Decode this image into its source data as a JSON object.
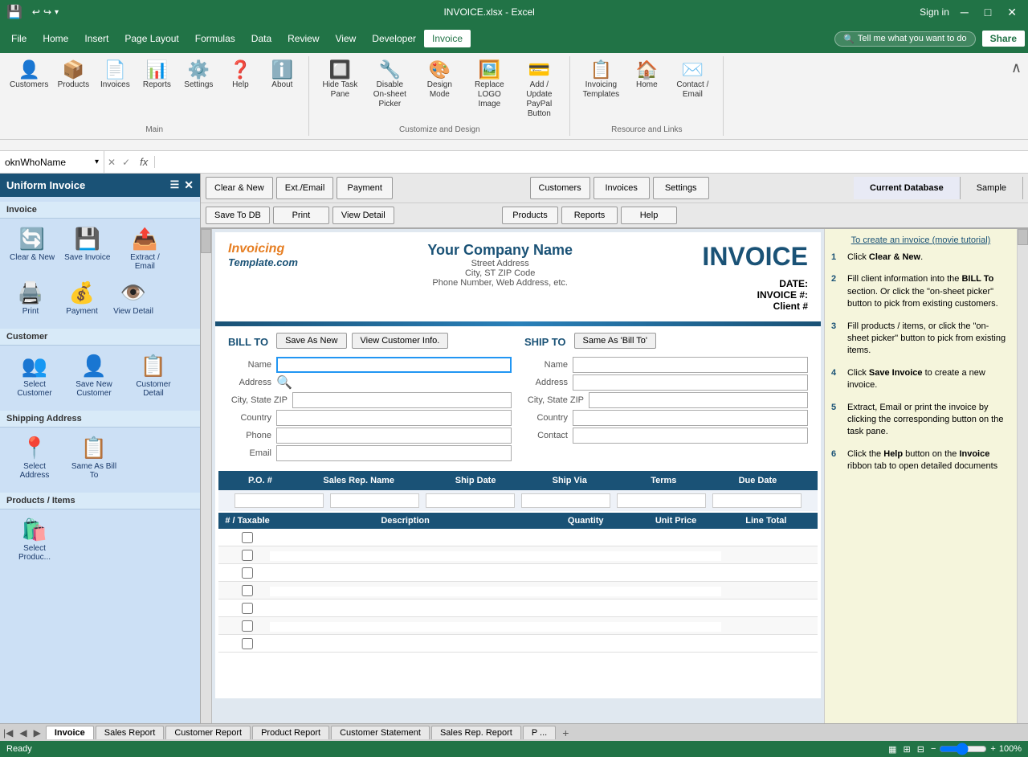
{
  "titleBar": {
    "title": "INVOICE.xlsx - Excel",
    "signIn": "Sign in"
  },
  "menuBar": {
    "items": [
      {
        "label": "File",
        "active": false
      },
      {
        "label": "Home",
        "active": false
      },
      {
        "label": "Insert",
        "active": false
      },
      {
        "label": "Page Layout",
        "active": false
      },
      {
        "label": "Formulas",
        "active": false
      },
      {
        "label": "Data",
        "active": false
      },
      {
        "label": "Review",
        "active": false
      },
      {
        "label": "View",
        "active": false
      },
      {
        "label": "Developer",
        "active": false
      },
      {
        "label": "Invoice",
        "active": true
      }
    ],
    "tellMe": "Tell me what you want to do",
    "share": "Share"
  },
  "ribbon": {
    "groups": [
      {
        "label": "Main",
        "items": [
          {
            "icon": "👤",
            "label": "Customers"
          },
          {
            "icon": "📦",
            "label": "Products"
          },
          {
            "icon": "📄",
            "label": "Invoices"
          },
          {
            "icon": "📊",
            "label": "Reports"
          },
          {
            "icon": "⚙️",
            "label": "Settings"
          },
          {
            "icon": "❓",
            "label": "Help"
          },
          {
            "icon": "ℹ️",
            "label": "About"
          }
        ]
      },
      {
        "label": "Customize and Design",
        "items": [
          {
            "icon": "🔲",
            "label": "Hide Task Pane"
          },
          {
            "icon": "🔧",
            "label": "Disable On-sheet Picker"
          },
          {
            "icon": "🎨",
            "label": "Design Mode"
          },
          {
            "icon": "🖼️",
            "label": "Replace LOGO Image"
          },
          {
            "icon": "💳",
            "label": "Add / Update PayPal Button"
          }
        ]
      },
      {
        "label": "Resource and Links",
        "items": [
          {
            "icon": "📋",
            "label": "Invoicing Templates"
          },
          {
            "icon": "🏠",
            "label": "Home"
          },
          {
            "icon": "✉️",
            "label": "Contact / Email"
          }
        ]
      }
    ]
  },
  "formulaBar": {
    "nameBox": "oknWhoName",
    "formula": ""
  },
  "actionButtons": {
    "row1": [
      {
        "label": "Clear & New",
        "id": "clear-new"
      },
      {
        "label": "Ext./Email",
        "id": "ext-email"
      },
      {
        "label": "Payment",
        "id": "payment"
      },
      {
        "label": "Customers",
        "id": "customers"
      },
      {
        "label": "Invoices",
        "id": "invoices"
      },
      {
        "label": "Settings",
        "id": "settings"
      }
    ],
    "row2": [
      {
        "label": "Save To DB",
        "id": "save-db"
      },
      {
        "label": "Print",
        "id": "print"
      },
      {
        "label": "View Detail",
        "id": "view-detail"
      },
      {
        "label": "Products",
        "id": "products"
      },
      {
        "label": "Reports",
        "id": "reports"
      },
      {
        "label": "Help",
        "id": "help"
      }
    ]
  },
  "dbTabs": [
    {
      "label": "Current Database",
      "active": true
    },
    {
      "label": "Sample",
      "active": false
    }
  ],
  "taskPane": {
    "title": "Uniform Invoice",
    "sections": [
      {
        "label": "Invoice",
        "items": [
          {
            "icon": "🔄",
            "label": "Clear & New"
          },
          {
            "icon": "💾",
            "label": "Save Invoice"
          },
          {
            "icon": "📤",
            "label": "Extract / Email"
          },
          {
            "icon": "🖨️",
            "label": "Print"
          },
          {
            "icon": "💰",
            "label": "Payment"
          },
          {
            "icon": "👁️",
            "label": "View Detail"
          }
        ]
      },
      {
        "label": "Customer",
        "items": [
          {
            "icon": "👥",
            "label": "Select Customer"
          },
          {
            "icon": "👤",
            "label": "Save New Customer"
          },
          {
            "icon": "📋",
            "label": "Customer Detail"
          }
        ]
      },
      {
        "label": "Shipping Address",
        "items": [
          {
            "icon": "📍",
            "label": "Select Address"
          },
          {
            "icon": "📋",
            "label": "Same As Bill To"
          }
        ]
      },
      {
        "label": "Products / Items",
        "items": [
          {
            "icon": "🛍️",
            "label": "Select Produc..."
          }
        ]
      }
    ]
  },
  "invoice": {
    "logoText": "Invoicing",
    "logoSub": "Template.com",
    "companyName": "Your Company Name",
    "companyAddr": "Street Address",
    "companyCityZip": "City, ST  ZIP Code",
    "companyPhone": "Phone Number, Web Address, etc.",
    "title": "INVOICE",
    "dateLabel": "DATE:",
    "invoiceNumLabel": "INVOICE #:",
    "clientLabel": "Client #",
    "billToLabel": "BILL TO",
    "shipToLabel": "SHIP TO",
    "saveAsNew": "Save As New",
    "viewCustomerInfo": "View Customer Info.",
    "sameAsBillTo": "Same As 'Bill To'",
    "fields": {
      "name": "Name",
      "address": "Address",
      "cityStateZip": "City, State ZIP",
      "country": "Country",
      "phone": "Phone",
      "email": "Email",
      "contact": "Contact"
    },
    "tableHeaders": {
      "po": "P.O. #",
      "salesRep": "Sales Rep. Name",
      "shipDate": "Ship Date",
      "shipVia": "Ship Via",
      "terms": "Terms",
      "dueDate": "Due Date"
    },
    "itemsHeaders": {
      "numTaxable": "# / Taxable",
      "description": "Description",
      "quantity": "Quantity",
      "unitPrice": "Unit Price",
      "lineTotal": "Line Total"
    },
    "itemRows": 7
  },
  "helpPanel": {
    "linkText": "To create an invoice (movie tutorial)",
    "steps": [
      {
        "num": "1",
        "text": "Click Clear & New."
      },
      {
        "num": "2",
        "text": "Fill client information into the BILL To section. Or click the \"on-sheet picker\" button to pick from existing customers."
      },
      {
        "num": "3",
        "text": "Fill products / items, or click the \"on-sheet picker\" button to pick from existing items."
      },
      {
        "num": "4",
        "text": "Click Save Invoice to create a new invoice."
      },
      {
        "num": "5",
        "text": "Extract, Email or print the invoice by clicking the corresponding button on the task pane."
      },
      {
        "num": "6",
        "text": "Click the Help button on the Invoice ribbon tab to open detailed documents"
      }
    ]
  },
  "sheetTabs": [
    {
      "label": "Invoice",
      "active": true
    },
    {
      "label": "Sales Report",
      "active": false
    },
    {
      "label": "Customer Report",
      "active": false
    },
    {
      "label": "Product Report",
      "active": false
    },
    {
      "label": "Customer Statement",
      "active": false
    },
    {
      "label": "Sales Rep. Report",
      "active": false
    },
    {
      "label": "P ...",
      "active": false
    }
  ],
  "statusBar": {
    "ready": "Ready",
    "zoom": "100%"
  }
}
